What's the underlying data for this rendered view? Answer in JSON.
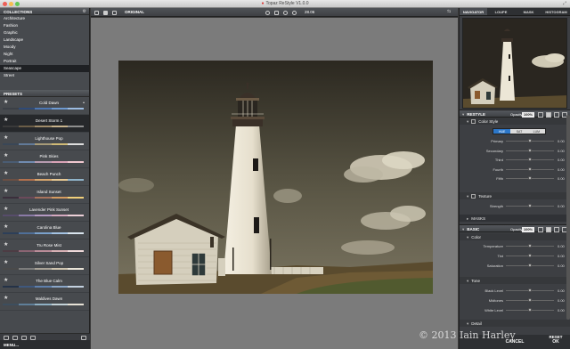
{
  "window": {
    "title": "Topaz ReStyle V1.0.0",
    "logo": "●"
  },
  "collections": {
    "header": "COLLECTIONS",
    "items": [
      "Architecture",
      "Fashion",
      "Graphic",
      "Landscape",
      "Moody",
      "Night",
      "Portrait",
      "Seascape",
      "Street"
    ],
    "selected": "Seascape"
  },
  "presets": {
    "header": "PRESETS",
    "items": [
      {
        "name": "Cold Dawn",
        "colors": [
          "#3c4047",
          "#2f4a76",
          "#4b76b3",
          "#6e9ad1",
          "#9cbce2"
        ]
      },
      {
        "name": "Desert Storm 1",
        "colors": [
          "#3a3a3a",
          "#6b5d47",
          "#a08c6a",
          "#c7b38c",
          "#8e8e8e"
        ]
      },
      {
        "name": "Lighthouse Pop",
        "colors": [
          "#3a4757",
          "#627a99",
          "#a79b78",
          "#cfba76",
          "#dedede"
        ]
      },
      {
        "name": "Pink Skies",
        "colors": [
          "#4a5c73",
          "#708bb0",
          "#b69bb0",
          "#d9a3b7",
          "#f0c8d0"
        ]
      },
      {
        "name": "Beach Punch",
        "colors": [
          "#6a4f44",
          "#b3704d",
          "#d8a66d",
          "#e7c893",
          "#8fb3c9"
        ]
      },
      {
        "name": "Island Sunset",
        "colors": [
          "#3b2f3c",
          "#6b4a5a",
          "#a7725d",
          "#d49b60",
          "#f0cf7a"
        ]
      },
      {
        "name": "Lavender Pink Sunset",
        "colors": [
          "#574c6b",
          "#8a7aa6",
          "#b59ac2",
          "#d5a9c0",
          "#ecd0d8"
        ]
      },
      {
        "name": "Carolina Blue",
        "colors": [
          "#2d3f59",
          "#4f6f99",
          "#7aa1cb",
          "#a4c3e3",
          "#d9e4ee"
        ]
      },
      {
        "name": "Tru Rose Mist",
        "colors": [
          "#4d3c44",
          "#8a6472",
          "#b98c98",
          "#d7b1b5",
          "#efdada"
        ]
      },
      {
        "name": "Silver Sand Pop",
        "colors": [
          "#4a4a4a",
          "#7d7d7d",
          "#a9a398",
          "#cfc5b0",
          "#e9e4d8"
        ]
      },
      {
        "name": "The Blue Calm",
        "colors": [
          "#243247",
          "#3f587d",
          "#5f80ad",
          "#8aa6c8",
          "#c3d1e0"
        ]
      },
      {
        "name": "Maldives Dawn",
        "colors": [
          "#3d4e5e",
          "#5f7f99",
          "#8fb0c4",
          "#c3d2d8",
          "#e7e2d6"
        ]
      }
    ],
    "selected": "Desert Storm 1"
  },
  "menu_label": "MENU...",
  "toolbar": {
    "original_label": "ORIGINAL",
    "zoom": "28.06"
  },
  "navigator_tabs": [
    "NAVIGATOR",
    "LOUPE",
    "MASK",
    "HISTOGRAM"
  ],
  "restyle": {
    "title": "RESTYLE",
    "opacity_label": "Opacity",
    "opacity": "100%",
    "color_style_label": "Color Style",
    "modes": [
      "HUE",
      "SAT",
      "LUM"
    ],
    "mode_selected": "HUE",
    "sliders": [
      {
        "label": "Primary",
        "value": "0.00",
        "pos": 0.5
      },
      {
        "label": "Secondary",
        "value": "0.00",
        "pos": 0.5
      },
      {
        "label": "Third",
        "value": "0.00",
        "pos": 0.5
      },
      {
        "label": "Fourth",
        "value": "0.00",
        "pos": 0.5
      },
      {
        "label": "Fifth",
        "value": "0.00",
        "pos": 0.5
      }
    ],
    "texture_label": "Texture",
    "strength": {
      "label": "Strength",
      "value": "0.00",
      "pos": 0.5
    },
    "masks_label": "MASKS"
  },
  "basic": {
    "title": "BASIC",
    "opacity_label": "Opacity",
    "opacity": "100%",
    "color_label": "Color",
    "color_sliders": [
      {
        "label": "Temperature",
        "value": "0.00",
        "pos": 0.5
      },
      {
        "label": "Tint",
        "value": "0.00",
        "pos": 0.5
      },
      {
        "label": "Saturation",
        "value": "0.00",
        "pos": 0.5
      }
    ],
    "tone_label": "Tone",
    "tone_sliders": [
      {
        "label": "Black Level",
        "value": "0.00",
        "pos": 0.5
      },
      {
        "label": "Midtones",
        "value": "0.00",
        "pos": 0.5
      },
      {
        "label": "White Level",
        "value": "0.00",
        "pos": 0.5
      }
    ],
    "detail_label": "Detail"
  },
  "buttons": {
    "reset": "RESET",
    "cancel": "CANCEL",
    "ok": "OK"
  },
  "watermark": "© 2013 Iain Harley"
}
